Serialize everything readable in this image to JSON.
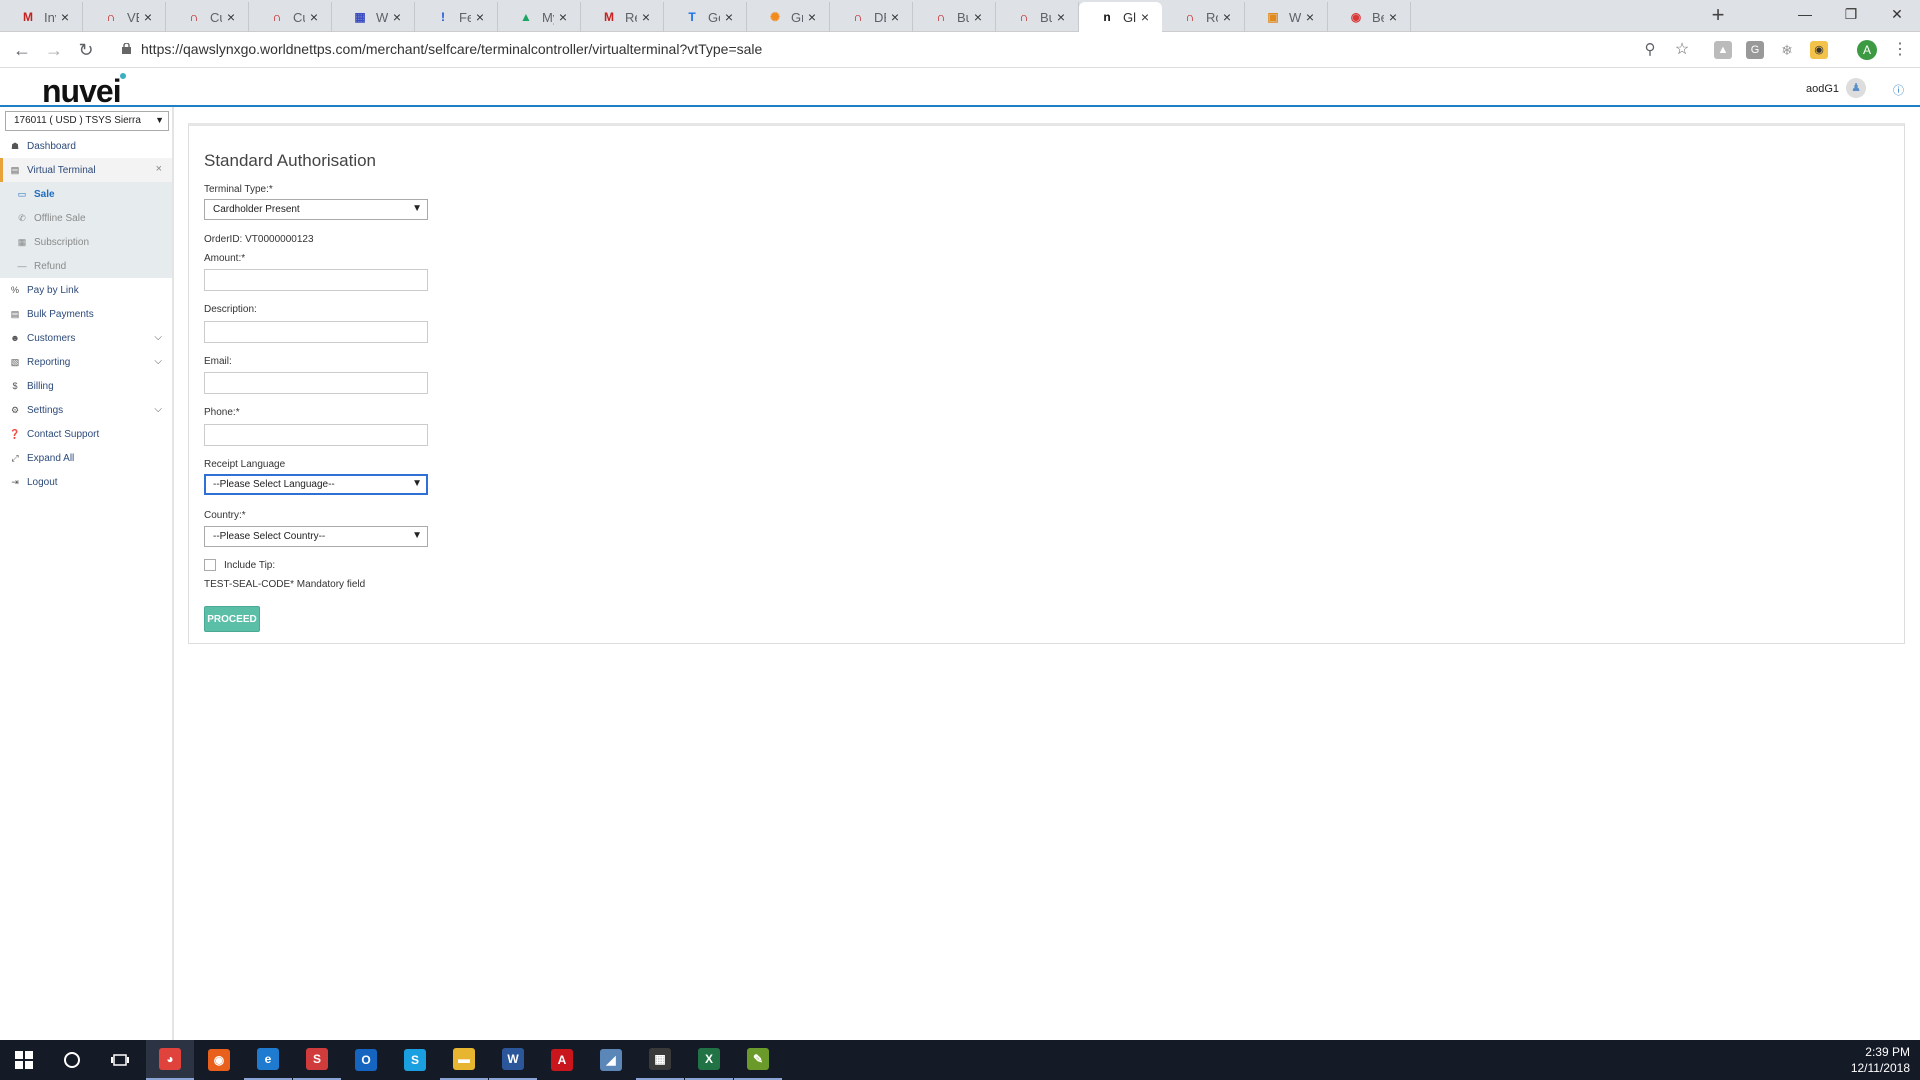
{
  "browser": {
    "tabs": [
      {
        "title": "Invitati",
        "icon": "gmail-icon",
        "color": "#c5221f",
        "glyph": "M"
      },
      {
        "title": "VERSIO",
        "icon": "jira-icon",
        "color": "#c00000",
        "glyph": "∩"
      },
      {
        "title": "Custom",
        "icon": "jira-icon",
        "color": "#c00000",
        "glyph": "∩"
      },
      {
        "title": "Custom",
        "icon": "jira-icon",
        "color": "#c00000",
        "glyph": "∩"
      },
      {
        "title": "Worldn",
        "icon": "worldnet-icon",
        "color": "#3b4cc0",
        "glyph": "▦"
      },
      {
        "title": "Featur",
        "icon": "feature-icon",
        "color": "#1a53d6",
        "glyph": "!"
      },
      {
        "title": "My Dri",
        "icon": "drive-icon",
        "color": "#1da462",
        "glyph": "▲"
      },
      {
        "title": "Remed",
        "icon": "gmail-icon",
        "color": "#c5221f",
        "glyph": "M"
      },
      {
        "title": "GoChi",
        "icon": "doc-icon",
        "color": "#1a73e8",
        "glyph": "T"
      },
      {
        "title": "Grafan",
        "icon": "grafana-icon",
        "color": "#f38b1c",
        "glyph": "✺"
      },
      {
        "title": "DB SE",
        "icon": "jira-icon",
        "color": "#c00000",
        "glyph": "∩"
      },
      {
        "title": "Bug #",
        "icon": "jira-icon",
        "color": "#c00000",
        "glyph": "∩"
      },
      {
        "title": "Bug #",
        "icon": "jira-icon",
        "color": "#c00000",
        "glyph": "∩"
      },
      {
        "title": "Global",
        "icon": "nuvei-icon",
        "color": "#111111",
        "glyph": "n"
      },
      {
        "title": "Roadm",
        "icon": "jira-icon",
        "color": "#c00000",
        "glyph": "∩"
      },
      {
        "title": "Whole",
        "icon": "bookmark-icon",
        "color": "#e08a1e",
        "glyph": "▣"
      },
      {
        "title": "Best fo",
        "icon": "bestfor-icon",
        "color": "#d93838",
        "glyph": "◉"
      }
    ],
    "active_tab": 13,
    "url": "https://qawslynxgo.worldnettps.com/merchant/selfcare/terminalcontroller/virtualterminal?vtType=sale",
    "profile_initial": "A"
  },
  "header": {
    "logo": "nuvei",
    "username": "aodG1"
  },
  "sidebar": {
    "merchant_select": "176011 ( USD ) TSYS Sierra",
    "items": [
      {
        "label": "Dashboard",
        "icon": "dashboard-icon",
        "glyph": "☗",
        "expandable": false
      },
      {
        "label": "Virtual Terminal",
        "icon": "terminal-icon",
        "glyph": "▤",
        "expandable": false,
        "open": true
      },
      {
        "label": "Sale",
        "icon": "card-icon",
        "glyph": "▭",
        "sub": true,
        "current": true
      },
      {
        "label": "Offline Sale",
        "icon": "phone-icon",
        "glyph": "✆",
        "sub": true
      },
      {
        "label": "Subscription",
        "icon": "calendar-icon",
        "glyph": "▦",
        "sub": true
      },
      {
        "label": "Refund",
        "icon": "minus-icon",
        "glyph": "—",
        "sub": true
      },
      {
        "label": "Pay by Link",
        "icon": "link-icon",
        "glyph": "%",
        "expandable": false
      },
      {
        "label": "Bulk Payments",
        "icon": "file-icon",
        "glyph": "▤",
        "expandable": false
      },
      {
        "label": "Customers",
        "icon": "users-icon",
        "glyph": "☻",
        "expandable": true
      },
      {
        "label": "Reporting",
        "icon": "report-icon",
        "glyph": "▧",
        "expandable": true
      },
      {
        "label": "Billing",
        "icon": "dollar-icon",
        "glyph": "$",
        "expandable": false
      },
      {
        "label": "Settings",
        "icon": "gear-icon",
        "glyph": "⚙",
        "expandable": true
      },
      {
        "label": "Contact Support",
        "icon": "question-icon",
        "glyph": "❓",
        "expandable": false
      },
      {
        "label": "Expand All",
        "icon": "expand-icon",
        "glyph": "⤢",
        "expandable": false
      },
      {
        "label": "Logout",
        "icon": "logout-icon",
        "glyph": "⇥",
        "expandable": false
      }
    ]
  },
  "form": {
    "title": "Standard Authorisation",
    "terminal_type_label": "Terminal Type:*",
    "terminal_type_value": "Cardholder Present",
    "order_id": "OrderID: VT0000000123",
    "amount_label": "Amount:*",
    "description_label": "Description:",
    "email_label": "Email:",
    "phone_label": "Phone:*",
    "receipt_language_label": "Receipt Language",
    "receipt_language_value": "--Please Select Language--",
    "country_label": "Country:*",
    "country_value": "--Please Select Country--",
    "include_tip_label": "Include Tip:",
    "mandatory_note": "TEST-SEAL-CODE* Mandatory field",
    "proceed_label": "PROCEED"
  },
  "taskbar": {
    "apps": [
      {
        "name": "chrome",
        "icon": "chrome-icon",
        "color": "#e0433b",
        "glyph": "◕",
        "running": true,
        "active": true
      },
      {
        "name": "firefox",
        "icon": "firefox-icon",
        "color": "#e8601c",
        "glyph": "◉",
        "running": false
      },
      {
        "name": "edge",
        "icon": "edge-icon",
        "color": "#1e7bd0",
        "glyph": "e",
        "running": true
      },
      {
        "name": "snagit",
        "icon": "snagit-icon",
        "color": "#d03b3b",
        "glyph": "S",
        "running": true
      },
      {
        "name": "outlook",
        "icon": "outlook-icon",
        "color": "#1565c0",
        "glyph": "O",
        "running": false
      },
      {
        "name": "skype",
        "icon": "skype-icon",
        "color": "#1a9fe0",
        "glyph": "S",
        "running": false
      },
      {
        "name": "explorer",
        "icon": "folder-icon",
        "color": "#e8b530",
        "glyph": "▬",
        "running": true
      },
      {
        "name": "word",
        "icon": "word-icon",
        "color": "#2b579a",
        "glyph": "W",
        "running": true
      },
      {
        "name": "acrobat",
        "icon": "acrobat-icon",
        "color": "#c9161d",
        "glyph": "A",
        "running": false
      },
      {
        "name": "notes",
        "icon": "notes-icon",
        "color": "#5a86b8",
        "glyph": "◢",
        "running": false
      },
      {
        "name": "calculator",
        "icon": "calculator-icon",
        "color": "#3a3a3a",
        "glyph": "▦",
        "running": true
      },
      {
        "name": "excel",
        "icon": "excel-icon",
        "color": "#217346",
        "glyph": "X",
        "running": true
      },
      {
        "name": "notepadpp",
        "icon": "notepad-icon",
        "color": "#6a9a2a",
        "glyph": "✎",
        "running": true
      }
    ],
    "time": "2:39 PM",
    "date": "12/11/2018"
  }
}
